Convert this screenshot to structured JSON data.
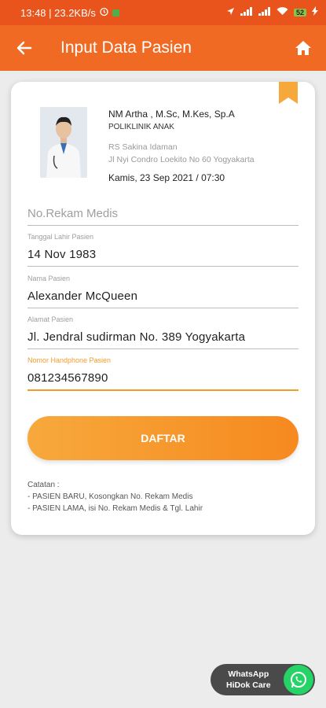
{
  "status_bar": {
    "time_speed": "13:48 | 23.2KB/s",
    "battery": "52"
  },
  "app_bar": {
    "title": "Input Data Pasien"
  },
  "doctor": {
    "name": "NM Artha , M.Sc, M.Kes, Sp.A",
    "clinic": "POLIKLINIK ANAK",
    "hospital": "RS Sakina Idaman",
    "address": "Jl Nyi Condro Loekito No 60 Yogyakarta",
    "schedule": "Kamis, 23 Sep 2021  /  07:30"
  },
  "form": {
    "rekam_medis_placeholder": "No.Rekam Medis",
    "dob_label": "Tanggal Lahir Pasien",
    "dob_value": "14 Nov 1983",
    "name_label": "Nama Pasien",
    "name_value": "Alexander McQueen",
    "address_label": "Alamat Pasien",
    "address_value": "Jl. Jendral sudirman No. 389 Yogyakarta",
    "phone_label": "Nomor Handphone Pasien",
    "phone_value": "081234567890"
  },
  "submit_label": "DAFTAR",
  "notes": {
    "title": "Catatan :",
    "line1": "- PASIEN BARU, Kosongkan No. Rekam Medis",
    "line2": "- PASIEN LAMA, isi No. Rekam Medis & Tgl. Lahir"
  },
  "whatsapp": {
    "line1": "WhatsApp",
    "line2": "HiDok Care"
  },
  "colors": {
    "primary": "#f06a24",
    "accent": "#f39c2a",
    "whatsapp": "#25d366"
  }
}
